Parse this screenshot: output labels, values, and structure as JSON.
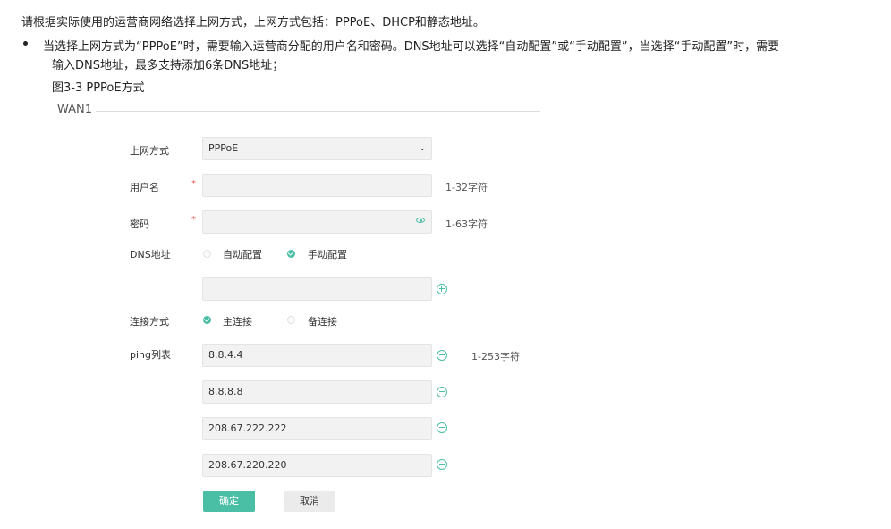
{
  "intro": "请根据实际使用的运营商网络选择上网方式，上网方式包括：PPPoE、DHCP和静态地址。",
  "bullet": {
    "line1": "当选择上网方式为“PPPoE”时，需要输入运营商分配的用户名和密码。DNS地址可以选择“自动配置”或“手动配置”，当选择“手动配置”时，需要",
    "line2": "输入DNS地址，最多支持添加6条DNS地址；"
  },
  "figure_caption": "图3-3 PPPoE方式",
  "section_title": "WAN1",
  "form": {
    "access_mode": {
      "label": "上网方式",
      "value": "PPPoE"
    },
    "username": {
      "label": "用户名",
      "required_mark": "*",
      "value": "",
      "hint": "1-32字符"
    },
    "password": {
      "label": "密码",
      "required_mark": "*",
      "value": "",
      "hint": "1-63字符"
    },
    "dns": {
      "label": "DNS地址",
      "options": [
        {
          "label": "自动配置",
          "selected": false
        },
        {
          "label": "手动配置",
          "selected": true
        }
      ],
      "value": ""
    },
    "connection": {
      "label": "连接方式",
      "options": [
        {
          "label": "主连接",
          "selected": true
        },
        {
          "label": "备连接",
          "selected": false
        }
      ]
    },
    "ping": {
      "label": "ping列表",
      "hint": "1-253字符",
      "entries": [
        "8.8.4.4",
        "8.8.8.8",
        "208.67.222.222",
        "208.67.220.220"
      ]
    }
  },
  "buttons": {
    "confirm": "确定",
    "cancel": "取消"
  },
  "colors": {
    "accent": "#4bbfa5",
    "required": "#ee5555"
  }
}
